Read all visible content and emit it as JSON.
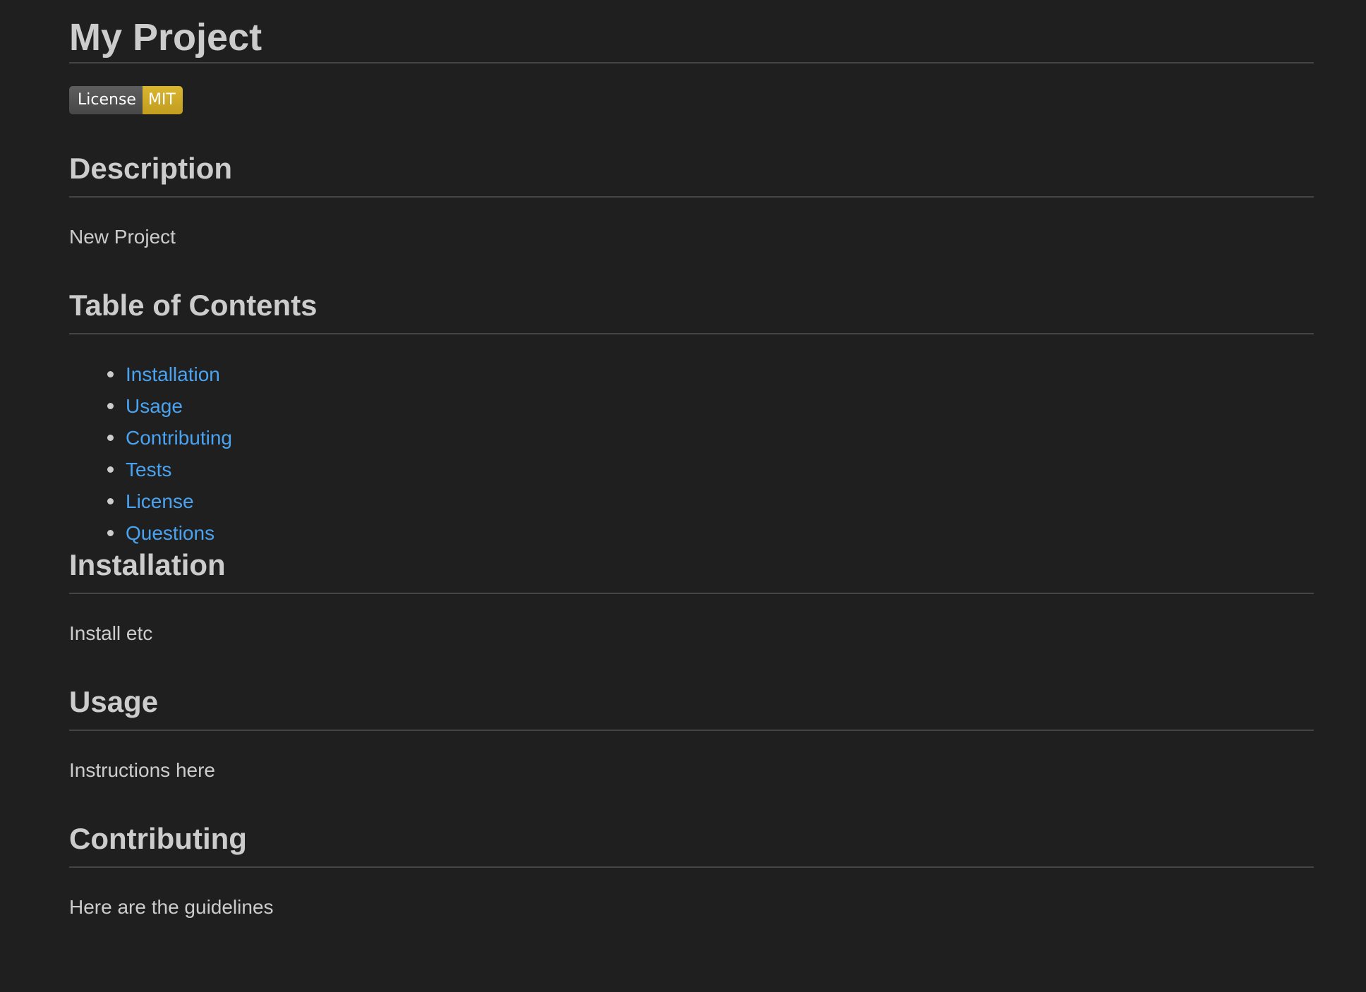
{
  "title": "My Project",
  "badge": {
    "label": "License",
    "value": "MIT",
    "label_color": "#555555",
    "value_color": "#d4af27"
  },
  "sections": {
    "description": {
      "heading": "Description",
      "body": "New Project"
    },
    "toc": {
      "heading": "Table of Contents",
      "items": [
        {
          "label": "Installation"
        },
        {
          "label": "Usage"
        },
        {
          "label": "Contributing"
        },
        {
          "label": "Tests"
        },
        {
          "label": "License"
        },
        {
          "label": "Questions"
        }
      ]
    },
    "installation": {
      "heading": "Installation",
      "body": "Install etc"
    },
    "usage": {
      "heading": "Usage",
      "body": "Instructions here"
    },
    "contributing": {
      "heading": "Contributing",
      "body": "Here are the guidelines"
    }
  },
  "colors": {
    "background": "#1f1f1f",
    "text": "#cccccc",
    "link": "#4aa3f0",
    "rule": "#454545"
  }
}
